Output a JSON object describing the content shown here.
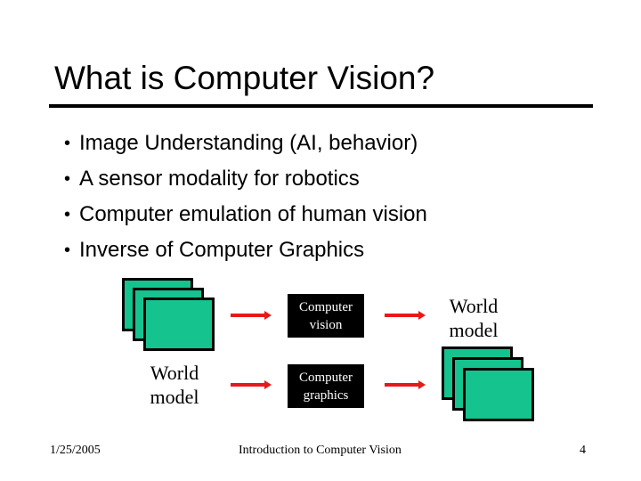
{
  "slide": {
    "title": "What is Computer Vision?",
    "bullets": [
      {
        "marker": "•",
        "text": "Image Understanding (AI, behavior)"
      },
      {
        "marker": "•",
        "text": "A sensor modality for robotics"
      },
      {
        "marker": "•",
        "text": "Computer emulation of human vision"
      },
      {
        "marker": "•",
        "text": "Inverse of Computer Graphics"
      }
    ],
    "diagram": {
      "image_stack_icon": "image-frames-icon",
      "arrow_icon": "arrow-right-icon",
      "frame_color": "#14c38e",
      "arrow_color": "#e8191a",
      "vision_box": {
        "line1": "Computer",
        "line2": "vision"
      },
      "graphics_box": {
        "line1": "Computer",
        "line2": "graphics"
      },
      "world_model_top": {
        "line1": "World",
        "line2": "model"
      },
      "world_model_bottom": {
        "line1": "World",
        "line2": "model"
      }
    },
    "footer": {
      "date": "1/25/2005",
      "course": "Introduction to Computer Vision",
      "page_number": "4"
    }
  }
}
